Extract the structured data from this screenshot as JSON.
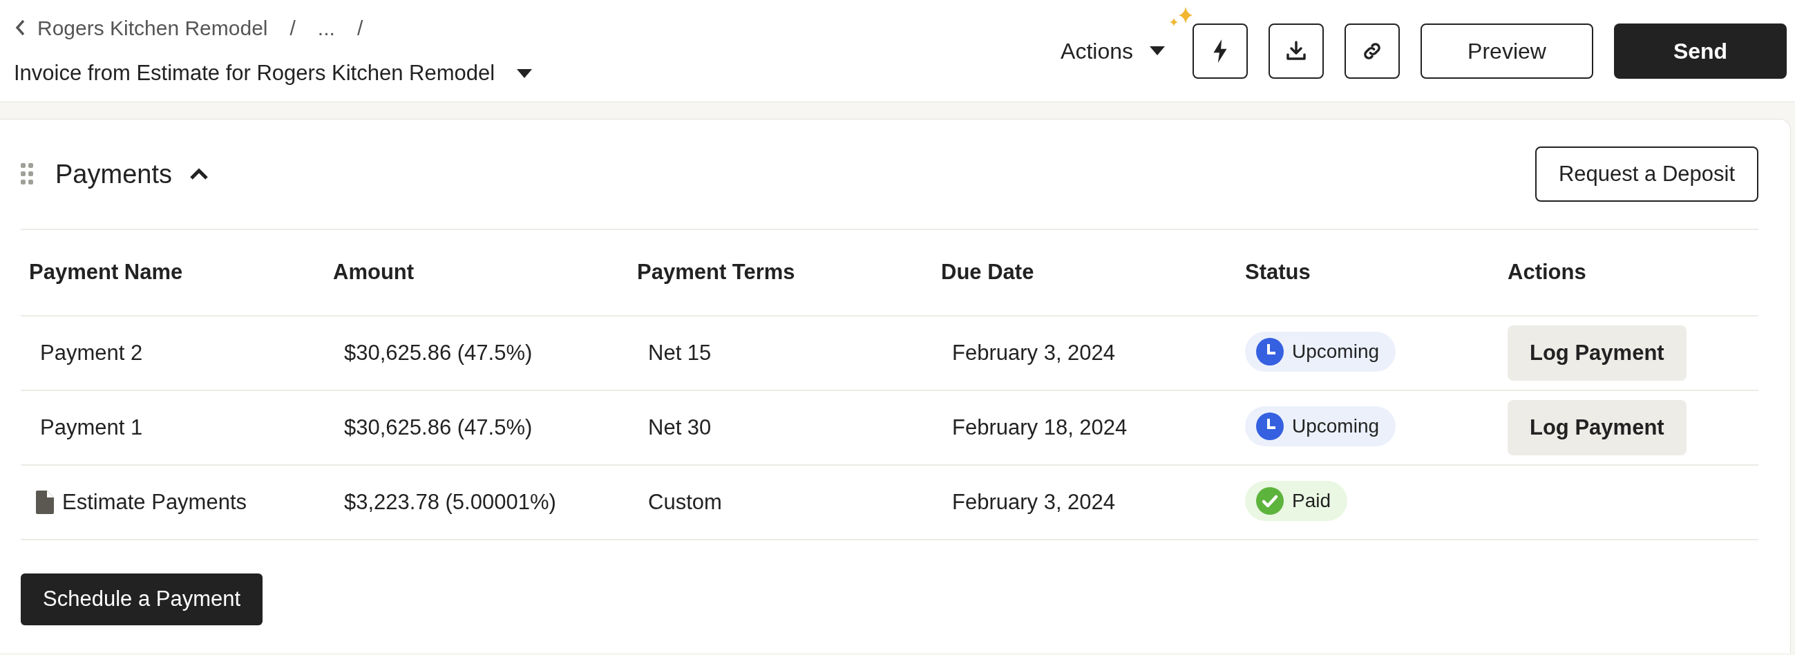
{
  "breadcrumb": {
    "items": [
      "Rogers Kitchen Remodel",
      "..."
    ],
    "separator": "/"
  },
  "document_title": "Invoice from Estimate for Rogers Kitchen Remodel",
  "toolbar": {
    "actions_label": "Actions",
    "buttons": [
      {
        "kind": "bolt"
      },
      {
        "kind": "download"
      },
      {
        "kind": "link"
      }
    ],
    "preview": "Preview",
    "send": "Send"
  },
  "section": {
    "title": "Payments",
    "expanded": true,
    "request_button": "Request a Deposit"
  },
  "table": {
    "columns": [
      "Payment Name",
      "Amount",
      "Payment Terms",
      "Due Date",
      "Status",
      "Actions"
    ],
    "rows": [
      {
        "name": "Payment 2",
        "document": false,
        "amount": "$30,625.86 (47.5%)",
        "terms": "Net 15",
        "due": "February 3, 2024",
        "status": {
          "kind": "upcoming",
          "label": "Upcoming"
        },
        "action": "Log Payment"
      },
      {
        "name": "Payment 1",
        "document": false,
        "amount": "$30,625.86 (47.5%)",
        "terms": "Net 30",
        "due": "February 18, 2024",
        "status": {
          "kind": "upcoming",
          "label": "Upcoming"
        },
        "action": "Log Payment"
      },
      {
        "name": "Estimate Payments",
        "document": true,
        "amount": "$3,223.78 (5.00001%)",
        "terms": "Custom",
        "due": "February 3, 2024",
        "status": {
          "kind": "paid",
          "label": "Paid"
        }
      }
    ]
  },
  "schedule_button": "Schedule a Payment"
}
